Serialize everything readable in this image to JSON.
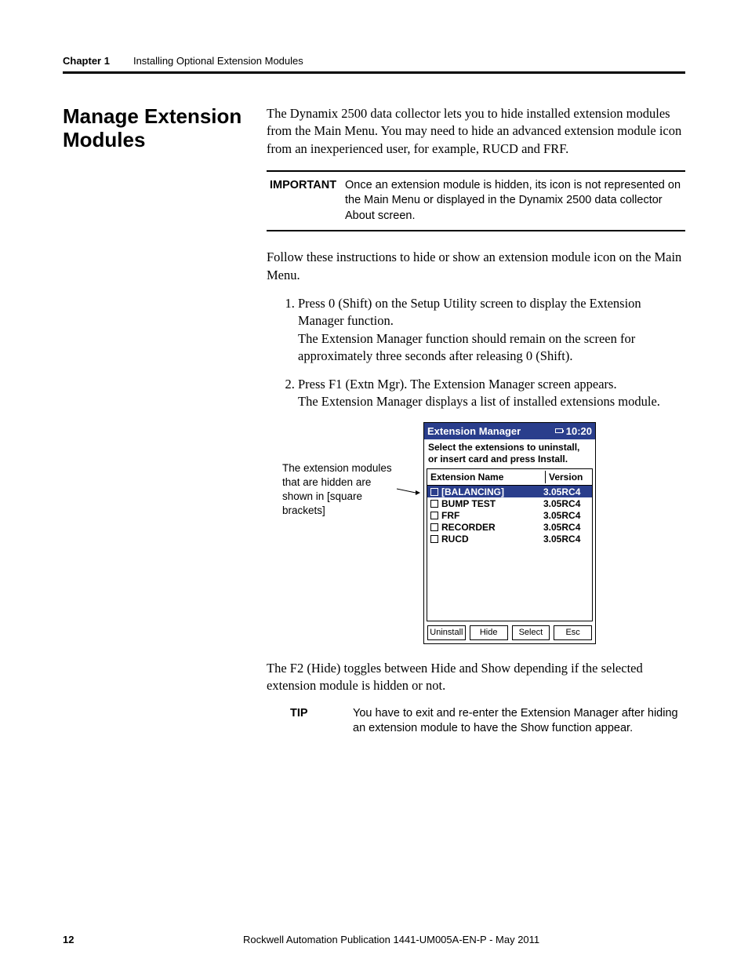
{
  "header": {
    "chapter": "Chapter 1",
    "title": "Installing Optional Extension Modules"
  },
  "section_heading": "Manage Extension Modules",
  "intro": "The Dynamix 2500 data collector lets you to hide installed extension modules from the Main Menu. You may need to hide an advanced extension module icon from an inexperienced user, for example, RUCD and FRF.",
  "important": {
    "label": "IMPORTANT",
    "body": "Once an extension module is hidden, its icon is not represented on the Main Menu or displayed in the Dynamix 2500 data collector About screen."
  },
  "follow": "Follow these instructions to hide or show an extension module icon on the Main Menu.",
  "steps": [
    {
      "text": "Press 0 (Shift) on the Setup Utility screen to display the Extension Manager function.",
      "note": "The Extension Manager function should remain on the screen for approximately three seconds after releasing 0 (Shift)."
    },
    {
      "text": "Press F1 (Extn Mgr). The Extension Manager screen appears.",
      "note": "The Extension Manager displays a list of installed extensions module."
    }
  ],
  "fig_caption": "The extension modules that are hidden are shown in [square brackets]",
  "device": {
    "title": "Extension Manager",
    "time": "10:20",
    "instr": "Select the extensions to uninstall, or insert card and press Install.",
    "col_name": "Extension Name",
    "col_ver": "Version",
    "rows": [
      {
        "name": "[BALANCING]",
        "ver": "3.05RC4",
        "selected": true
      },
      {
        "name": "BUMP TEST",
        "ver": "3.05RC4",
        "selected": false
      },
      {
        "name": "FRF",
        "ver": "3.05RC4",
        "selected": false
      },
      {
        "name": "RECORDER",
        "ver": "3.05RC4",
        "selected": false
      },
      {
        "name": "RUCD",
        "ver": "3.05RC4",
        "selected": false
      }
    ],
    "buttons": {
      "uninstall": "Uninstall",
      "hide": "Hide",
      "select": "Select",
      "esc": "Esc"
    }
  },
  "after_fig": "The F2 (Hide) toggles between Hide and Show depending if the selected extension module is hidden or not.",
  "tip": {
    "label": "TIP",
    "body": "You have to exit and re-enter the Extension Manager after hiding an extension module to have the Show function appear."
  },
  "footer": {
    "page": "12",
    "pub": "Rockwell Automation Publication 1441-UM005A-EN-P - May 2011"
  }
}
